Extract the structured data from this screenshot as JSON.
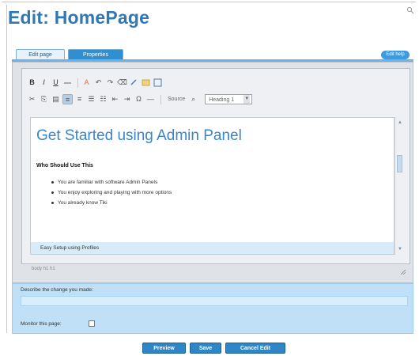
{
  "page": {
    "title": "Edit: HomePage",
    "corner_icon": "search-icon"
  },
  "tabs": [
    {
      "label": "Edit page"
    },
    {
      "label": "Properties"
    }
  ],
  "help_label": "Edit help",
  "toolbar": {
    "row1": [
      {
        "label": "B",
        "name": "bold-button"
      },
      {
        "label": "I",
        "name": "italic-button"
      },
      {
        "label": "U",
        "name": "underline-button"
      },
      {
        "label": "S",
        "name": "strike-button"
      },
      {
        "label": "A",
        "name": "text-color-button"
      }
    ],
    "source_label": "Source",
    "format_value": "Heading 1"
  },
  "content": {
    "heading": "Get Started using Admin Panel",
    "subheading": "Who Should Use This",
    "bullets": [
      "You are familiar with software Admin Panels",
      "You enjoy exploring and playing with more options",
      "You already know Tiki"
    ],
    "footer_heading": "Easy Setup using Profiles"
  },
  "status_path": "body  h1  h1",
  "describe": {
    "label": "Describe the change you made:",
    "input_value": ""
  },
  "monitor": {
    "label": "Monitor this page:",
    "checked": false
  },
  "actions": {
    "preview": "Preview",
    "save": "Save",
    "cancel": "Cancel Edit"
  },
  "colors": {
    "accent": "#2f78b4",
    "button": "#2f86c6",
    "describe_bg": "#bfe0f7"
  }
}
